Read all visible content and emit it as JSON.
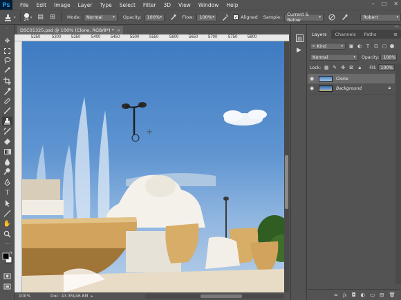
{
  "app": {
    "logo": "Ps"
  },
  "menu": [
    "File",
    "Edit",
    "Image",
    "Layer",
    "Type",
    "Select",
    "Filter",
    "3D",
    "View",
    "Window",
    "Help"
  ],
  "window_controls": {
    "minimize": "–",
    "maximize": "□",
    "close": "✕"
  },
  "options": {
    "brush_size": "24",
    "mode_label": "Mode:",
    "mode_value": "Normal",
    "opacity_label": "Opacity:",
    "opacity_value": "100%",
    "flow_label": "Flow:",
    "flow_value": "100%",
    "aligned_label": "Aligned",
    "sample_label": "Sample:",
    "sample_value": "Current & Below",
    "workspace_value": "Robert"
  },
  "document": {
    "tab_title": "DSC01325.psd @ 100% (Clone, RGB/8*) *",
    "close": "×",
    "ruler_labels": [
      "5250",
      "5300",
      "5350",
      "5400",
      "5450",
      "5500",
      "5550",
      "5600",
      "5650",
      "5700",
      "5750",
      "5800"
    ]
  },
  "status": {
    "zoom": "100%",
    "doc": "Doc: 43.3M/46.8M"
  },
  "layers_panel": {
    "tabs": [
      "Layers",
      "Channels",
      "Paths"
    ],
    "kind_value": "Kind",
    "blend_value": "Normal",
    "opacity_label": "Opacity:",
    "opacity_value": "100%",
    "lock_label": "Lock:",
    "fill_label": "Fill:",
    "fill_value": "100%",
    "layers": [
      {
        "name": "Clone",
        "selected": true
      },
      {
        "name": "Background",
        "selected": false
      }
    ]
  },
  "icons": {
    "tools": [
      "move-icon",
      "marquee-icon",
      "lasso-icon",
      "quick-select-icon",
      "crop-icon",
      "eyedropper-icon",
      "healing-icon",
      "brush-icon",
      "clone-stamp-icon",
      "history-brush-icon",
      "eraser-icon",
      "gradient-icon",
      "blur-icon",
      "dodge-icon",
      "pen-icon",
      "type-icon",
      "path-select-icon",
      "line-icon",
      "hand-icon",
      "zoom-icon",
      "more-tools-icon",
      "colors-icon",
      "quick-mask-icon",
      "screen-mode-icon"
    ]
  }
}
